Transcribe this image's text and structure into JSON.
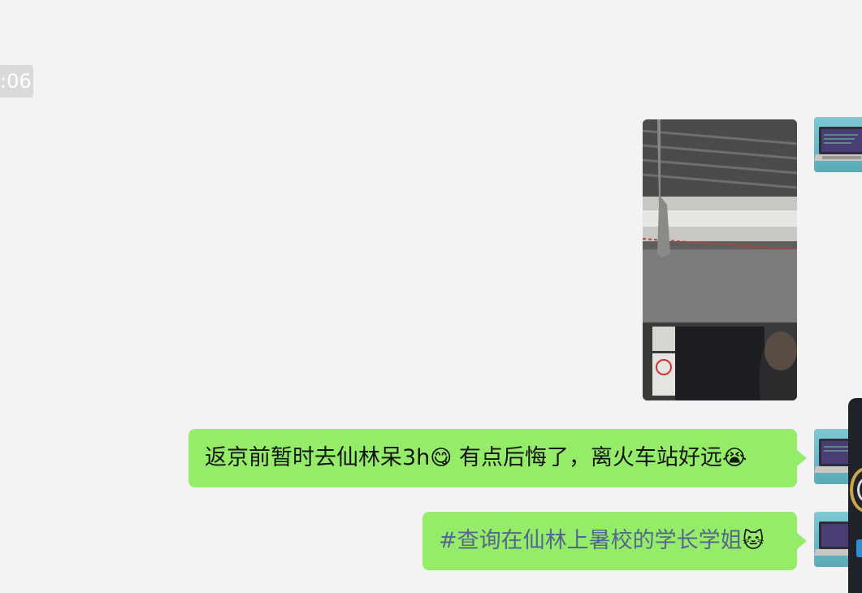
{
  "chat": {
    "timestamp": ":06",
    "messages": [
      {
        "type": "image",
        "sender": "me",
        "image_icon": "subway-car-photo"
      },
      {
        "type": "text",
        "sender": "me",
        "text": "返京前暂时去仙林呆3h",
        "emoji1": "😋",
        "text2": " 有点后悔了，离火车站好远",
        "emoji2": "😭"
      },
      {
        "type": "text",
        "sender": "me",
        "hashtag": "#查询在仙林上暑校的学长学姐",
        "emoji": "🐱"
      }
    ],
    "avatar_icon": "laptop-icon"
  },
  "colors": {
    "background": "#f3f3f3",
    "bubble": "#95ec69",
    "hashtag": "#56678f",
    "timestamp_bg": "#dadada"
  }
}
